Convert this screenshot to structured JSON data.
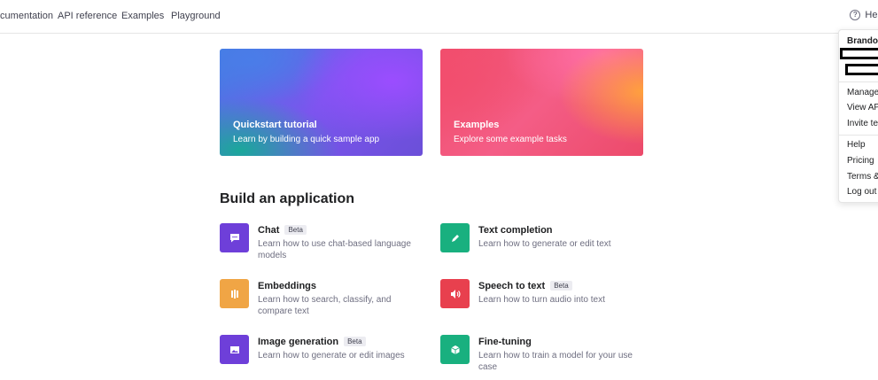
{
  "nav": {
    "links": [
      "Documentation",
      "API reference",
      "Examples",
      "Playground"
    ],
    "help_label": "Help"
  },
  "heroes": [
    {
      "title": "Quickstart tutorial",
      "subtitle": "Learn by building a quick sample app"
    },
    {
      "title": "Examples",
      "subtitle": "Explore some example tasks"
    }
  ],
  "section_title": "Build an application",
  "apps": [
    {
      "title": "Chat",
      "badge": "Beta",
      "desc": "Learn how to use chat-based language models",
      "icon": "chat-bubble-icon",
      "color": "#6e3fd9"
    },
    {
      "title": "Text completion",
      "badge": "",
      "desc": "Learn how to generate or edit text",
      "icon": "pencil-icon",
      "color": "#19b07f"
    },
    {
      "title": "Embeddings",
      "badge": "",
      "desc": "Learn how to search, classify, and compare text",
      "icon": "embeddings-icon",
      "color": "#f0a545"
    },
    {
      "title": "Speech to text",
      "badge": "Beta",
      "desc": "Learn how to turn audio into text",
      "icon": "speaker-icon",
      "color": "#e8404e"
    },
    {
      "title": "Image generation",
      "badge": "Beta",
      "desc": "Learn how to generate or edit images",
      "icon": "image-icon",
      "color": "#6e3fd9"
    },
    {
      "title": "Fine-tuning",
      "badge": "",
      "desc": "Learn how to train a model for your use case",
      "icon": "cube-icon",
      "color": "#19b07f"
    }
  ],
  "menu": {
    "user": "Brandon",
    "group1": [
      "Manage account",
      "View API keys",
      "Invite team"
    ],
    "group2": [
      "Help",
      "Pricing",
      "Terms & policies",
      "Log out"
    ]
  }
}
